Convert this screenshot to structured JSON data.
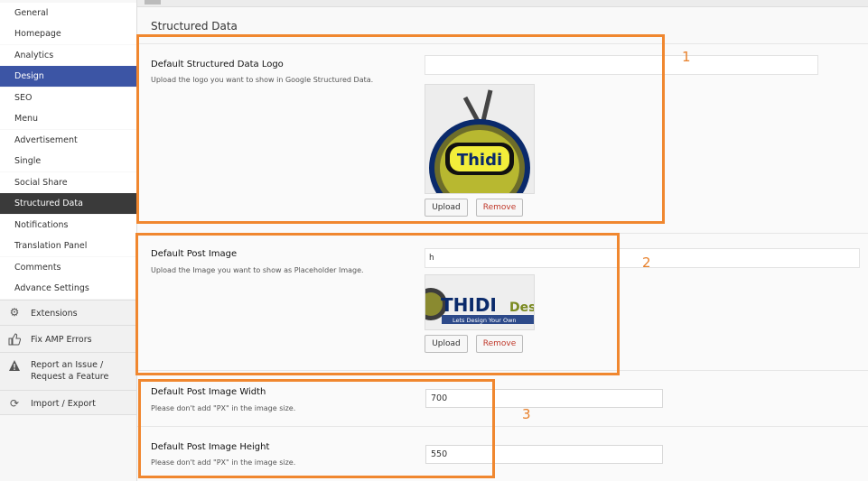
{
  "sidebar": {
    "items": [
      {
        "label": "General"
      },
      {
        "label": "Homepage"
      },
      {
        "label": "Analytics"
      },
      {
        "label": "Design"
      },
      {
        "label": "SEO"
      },
      {
        "label": "Menu"
      },
      {
        "label": "Advertisement"
      },
      {
        "label": "Single"
      },
      {
        "label": "Social Share"
      },
      {
        "label": "Structured Data"
      },
      {
        "label": "Notifications"
      },
      {
        "label": "Translation Panel"
      },
      {
        "label": "Comments"
      },
      {
        "label": "Advance Settings"
      }
    ],
    "extras": [
      {
        "label": "Extensions",
        "icon": "gear-icon"
      },
      {
        "label": "Fix AMP Errors",
        "icon": "thumbs-up-icon"
      },
      {
        "label_line1": "Report an Issue /",
        "label_line2": "Request a Feature",
        "icon": "warning-icon"
      },
      {
        "label": "Import / Export",
        "icon": "refresh-icon"
      }
    ]
  },
  "main": {
    "section_title": "Structured Data",
    "logo_field": {
      "title": "Default Structured Data Logo",
      "description": "Upload the logo you want to show in Google Structured Data.",
      "url_value": "",
      "logo_text": "Thidi",
      "upload_label": "Upload",
      "remove_label": "Remove"
    },
    "post_image_field": {
      "title": "Default Post Image",
      "description": "Upload the Image you want to show as Placeholder Image.",
      "url_value": "h",
      "banner_text_main": "THIDI",
      "banner_text_suffix": "Des",
      "banner_tagline": "Lets Design Your Own",
      "upload_label": "Upload",
      "remove_label": "Remove"
    },
    "width_field": {
      "title": "Default Post Image Width",
      "description": "Please don't add \"PX\" in the image size.",
      "value": "700"
    },
    "height_field": {
      "title": "Default Post Image Height",
      "description": "Please don't add \"PX\" in the image size.",
      "value": "550"
    }
  },
  "annotations": {
    "num1": "1",
    "num2": "2",
    "num3": "3",
    "color": "#f0872f"
  },
  "colors": {
    "active_blue": "#3c55a5",
    "active_dark": "#3a3a3a",
    "remove_red": "#c0392b"
  }
}
